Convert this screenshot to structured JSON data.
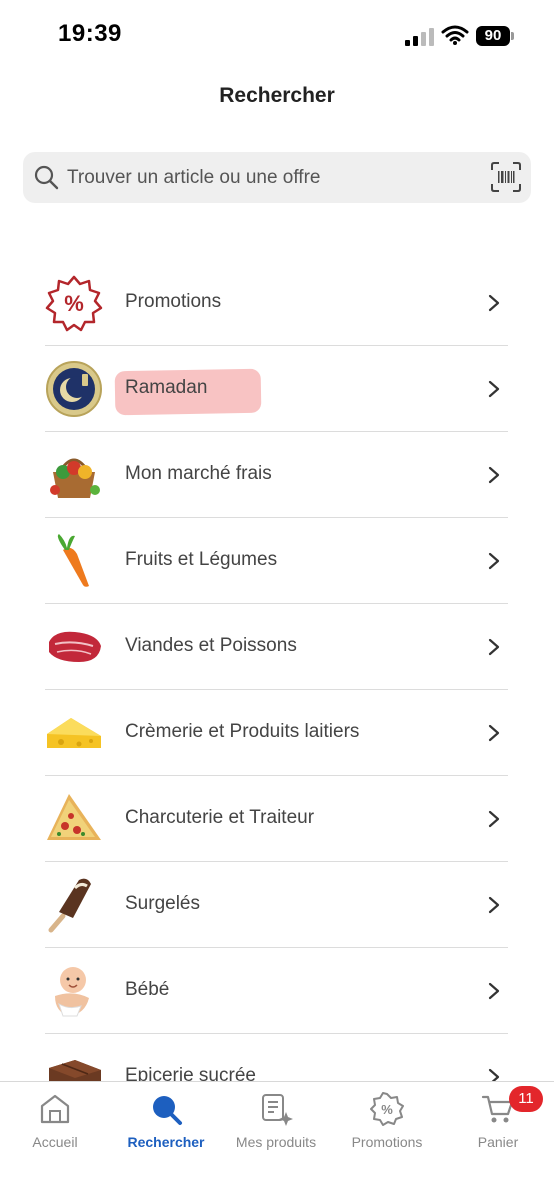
{
  "status_bar": {
    "time": "19:39",
    "battery": "90"
  },
  "header": {
    "title": "Rechercher"
  },
  "search": {
    "placeholder": "Trouver un article ou une offre"
  },
  "categories": [
    {
      "label": "Promotions",
      "icon": "promotion-badge-icon"
    },
    {
      "label": "Ramadan",
      "icon": "ramadan-crescent-icon"
    },
    {
      "label": "Mon marché frais",
      "icon": "fresh-basket-icon"
    },
    {
      "label": "Fruits et Légumes",
      "icon": "carrot-icon"
    },
    {
      "label": "Viandes et Poissons",
      "icon": "meat-icon"
    },
    {
      "label": "Crèmerie et Produits laitiers",
      "icon": "cheese-icon"
    },
    {
      "label": "Charcuterie et Traiteur",
      "icon": "pizza-icon"
    },
    {
      "label": "Surgelés",
      "icon": "ice-cream-icon"
    },
    {
      "label": "Bébé",
      "icon": "baby-icon"
    },
    {
      "label": "Epicerie sucrée",
      "icon": "chocolate-icon"
    }
  ],
  "tabs": [
    {
      "label": "Accueil",
      "icon": "home-icon"
    },
    {
      "label": "Rechercher",
      "icon": "search-icon",
      "active": true
    },
    {
      "label": "Mes produits",
      "icon": "list-sparkle-icon"
    },
    {
      "label": "Promotions",
      "icon": "percent-badge-icon"
    },
    {
      "label": "Panier",
      "icon": "cart-icon",
      "badge": "11"
    }
  ],
  "colors": {
    "accent": "#1d5fbf",
    "promo_red": "#b3262b",
    "badge_red": "#e3262b",
    "highlight": "#f7b9b9"
  }
}
